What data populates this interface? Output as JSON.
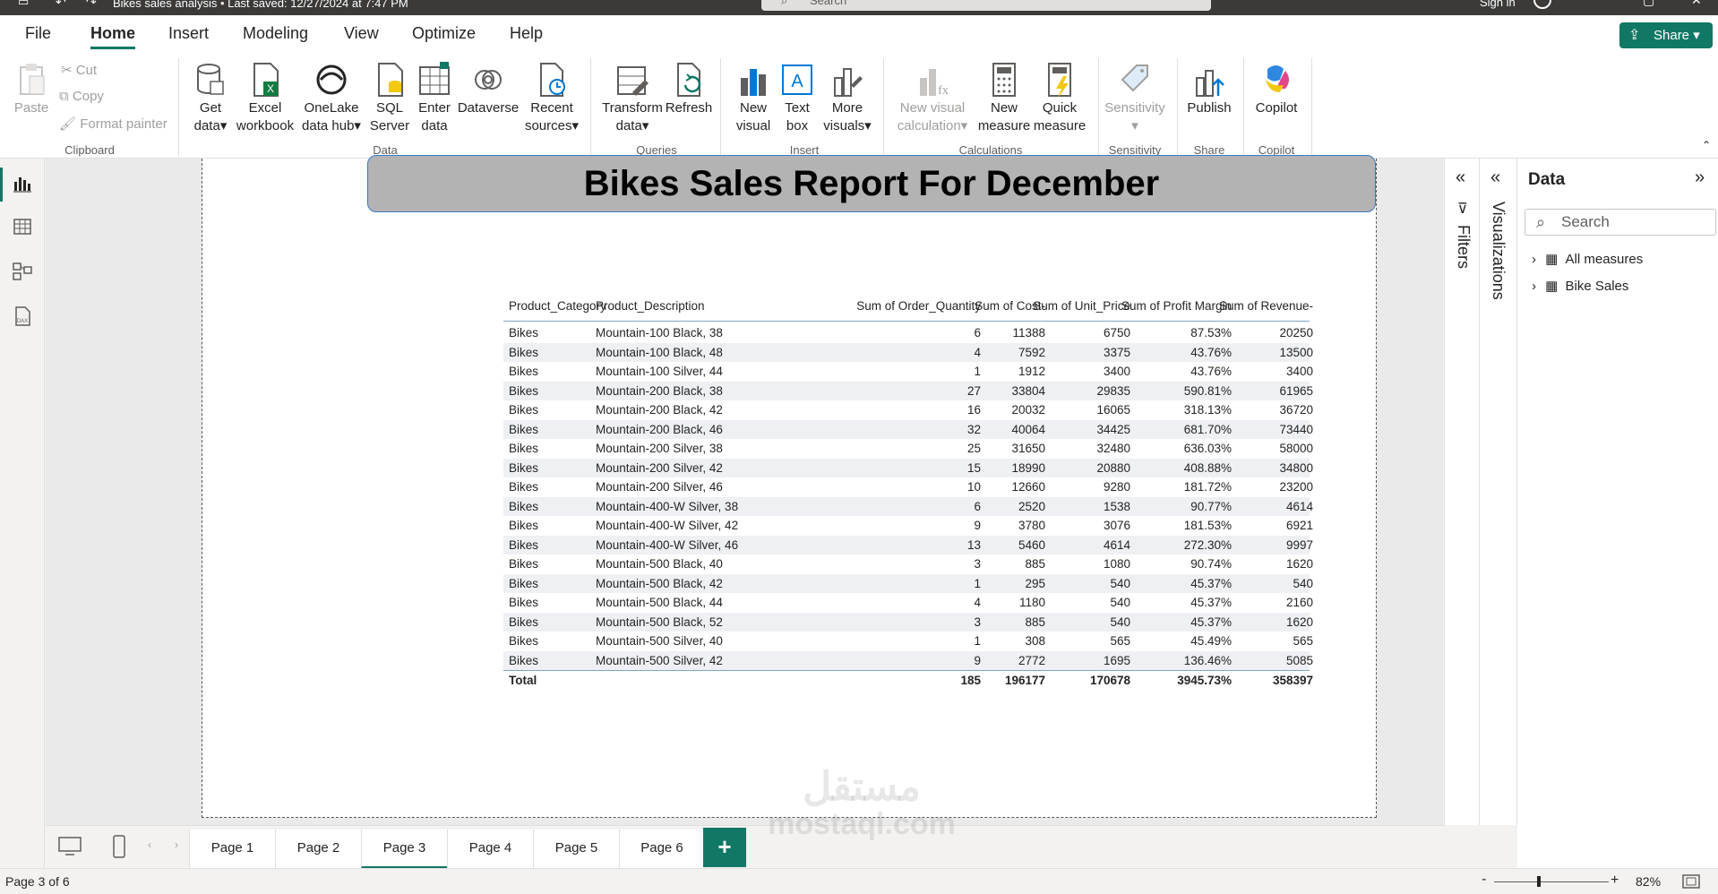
{
  "titlebar": {
    "doc_title": "Bikes sales analysis • Last saved: 12/27/2024 at 7:47 PM",
    "search_placeholder": "Search",
    "sign_in": "Sign in"
  },
  "tabs": [
    "File",
    "Home",
    "Insert",
    "Modeling",
    "View",
    "Optimize",
    "Help"
  ],
  "active_tab": "Home",
  "share_label": "Share",
  "ribbon": {
    "clipboard": {
      "paste": "Paste",
      "cut": "Cut",
      "copy": "Copy",
      "format_painter": "Format painter",
      "group": "Clipboard"
    },
    "data": {
      "get_data": [
        "Get",
        "data"
      ],
      "excel": [
        "Excel",
        "workbook"
      ],
      "onelake": [
        "OneLake",
        "data hub"
      ],
      "sql": [
        "SQL",
        "Server"
      ],
      "enter": [
        "Enter",
        "data"
      ],
      "dataverse": "Dataverse",
      "recent": [
        "Recent",
        "sources"
      ],
      "group": "Data"
    },
    "queries": {
      "transform": [
        "Transform",
        "data"
      ],
      "refresh": "Refresh",
      "group": "Queries"
    },
    "insert": {
      "new_visual": [
        "New",
        "visual"
      ],
      "text_box": [
        "Text",
        "box"
      ],
      "more_visuals": [
        "More",
        "visuals"
      ],
      "group": "Insert"
    },
    "calculations": {
      "new_visual_calc": [
        "New visual",
        "calculation"
      ],
      "new_measure": [
        "New",
        "measure"
      ],
      "quick_measure": [
        "Quick",
        "measure"
      ],
      "group": "Calculations"
    },
    "sensitivity": {
      "label": "Sensitivity",
      "group": "Sensitivity"
    },
    "share": {
      "publish": "Publish",
      "group": "Share"
    },
    "copilot": {
      "label": "Copilot",
      "group": "Copilot"
    }
  },
  "report": {
    "title": "Bikes Sales Report For December",
    "columns": [
      "Product_Category",
      "Product_Description",
      "Sum of Order_Quantity",
      "Sum of Cost-",
      "Sum of Unit_Price",
      "Sum of Profit Margin",
      "Sum of Revenue-"
    ],
    "rows": [
      [
        "Bikes",
        "Mountain-100 Black, 38",
        "6",
        "11388",
        "6750",
        "87.53%",
        "20250"
      ],
      [
        "Bikes",
        "Mountain-100 Black, 48",
        "4",
        "7592",
        "3375",
        "43.76%",
        "13500"
      ],
      [
        "Bikes",
        "Mountain-100 Silver, 44",
        "1",
        "1912",
        "3400",
        "43.76%",
        "3400"
      ],
      [
        "Bikes",
        "Mountain-200 Black, 38",
        "27",
        "33804",
        "29835",
        "590.81%",
        "61965"
      ],
      [
        "Bikes",
        "Mountain-200 Black, 42",
        "16",
        "20032",
        "16065",
        "318.13%",
        "36720"
      ],
      [
        "Bikes",
        "Mountain-200 Black, 46",
        "32",
        "40064",
        "34425",
        "681.70%",
        "73440"
      ],
      [
        "Bikes",
        "Mountain-200 Silver, 38",
        "25",
        "31650",
        "32480",
        "636.03%",
        "58000"
      ],
      [
        "Bikes",
        "Mountain-200 Silver, 42",
        "15",
        "18990",
        "20880",
        "408.88%",
        "34800"
      ],
      [
        "Bikes",
        "Mountain-200 Silver, 46",
        "10",
        "12660",
        "9280",
        "181.72%",
        "23200"
      ],
      [
        "Bikes",
        "Mountain-400-W Silver, 38",
        "6",
        "2520",
        "1538",
        "90.77%",
        "4614"
      ],
      [
        "Bikes",
        "Mountain-400-W Silver, 42",
        "9",
        "3780",
        "3076",
        "181.53%",
        "6921"
      ],
      [
        "Bikes",
        "Mountain-400-W Silver, 46",
        "13",
        "5460",
        "4614",
        "272.30%",
        "9997"
      ],
      [
        "Bikes",
        "Mountain-500 Black, 40",
        "3",
        "885",
        "1080",
        "90.74%",
        "1620"
      ],
      [
        "Bikes",
        "Mountain-500 Black, 42",
        "1",
        "295",
        "540",
        "45.37%",
        "540"
      ],
      [
        "Bikes",
        "Mountain-500 Black, 44",
        "4",
        "1180",
        "540",
        "45.37%",
        "2160"
      ],
      [
        "Bikes",
        "Mountain-500 Black, 52",
        "3",
        "885",
        "540",
        "45.37%",
        "1620"
      ],
      [
        "Bikes",
        "Mountain-500 Silver, 40",
        "1",
        "308",
        "565",
        "45.49%",
        "565"
      ],
      [
        "Bikes",
        "Mountain-500 Silver, 42",
        "9",
        "2772",
        "1695",
        "136.46%",
        "5085"
      ]
    ],
    "total": [
      "Total",
      "",
      "185",
      "196177",
      "170678",
      "3945.73%",
      "358397"
    ]
  },
  "panes": {
    "filters": "Filters",
    "visualizations": "Visualizations",
    "data_title": "Data",
    "data_search_placeholder": "Search",
    "tree": [
      "All measures",
      "Bike Sales"
    ]
  },
  "pages": [
    "Page 1",
    "Page 2",
    "Page 3",
    "Page 4",
    "Page 5",
    "Page 6"
  ],
  "active_page": "Page 3",
  "status": {
    "page_info": "Page 3 of 6",
    "zoom": "82%"
  },
  "watermark": {
    "arabic": "مستقل",
    "latin": "mostaql.com"
  },
  "colors": {
    "accent": "#117865",
    "title_box": "#b3b3b3",
    "title_border": "#3a7bc8"
  }
}
